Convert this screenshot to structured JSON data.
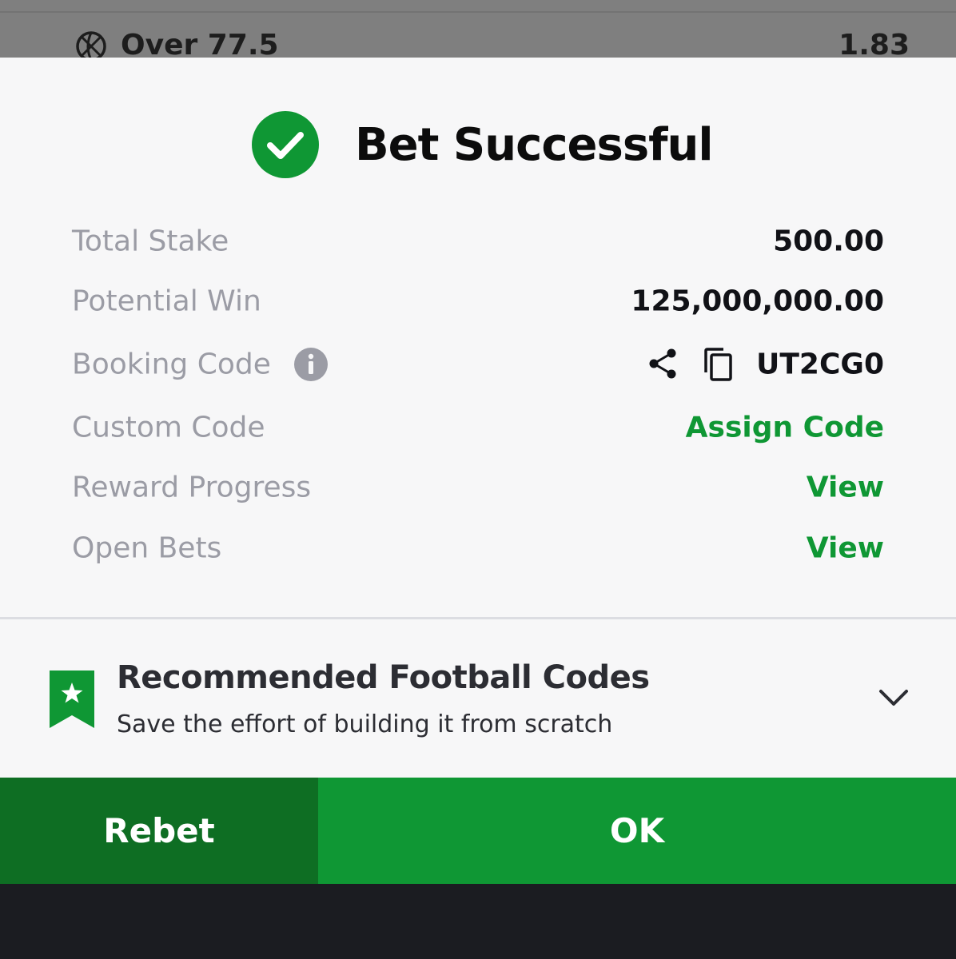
{
  "background": {
    "selection": "Over 77.5",
    "odds": "1.83",
    "sport_icon": "basketball-icon"
  },
  "dialog": {
    "status_icon": "check-circle-icon",
    "title": "Bet Successful",
    "rows": {
      "total_stake": {
        "label": "Total Stake",
        "value": "500.00"
      },
      "potential_win": {
        "label": "Potential Win",
        "value": "125,000,000.00"
      },
      "booking_code": {
        "label": "Booking Code",
        "value": "UT2CG0",
        "icons": [
          "info-icon",
          "share-icon",
          "copy-icon"
        ]
      },
      "custom_code": {
        "label": "Custom Code",
        "value": "Assign Code"
      },
      "reward_progress": {
        "label": "Reward Progress",
        "value": "View"
      },
      "open_bets": {
        "label": "Open Bets",
        "value": "View"
      }
    },
    "recommended": {
      "icon": "bookmark-star-icon",
      "title": "Recommended Football Codes",
      "subtitle": "Save the effort of building it from scratch",
      "toggle_icon": "chevron-down-icon"
    },
    "buttons": {
      "rebet": "Rebet",
      "ok": "OK"
    }
  },
  "colors": {
    "accent_green": "#0f9734",
    "dark_green": "#0e6e23",
    "label_gray": "#9b9ca5",
    "overlay_gray": "#7f7f7f"
  }
}
